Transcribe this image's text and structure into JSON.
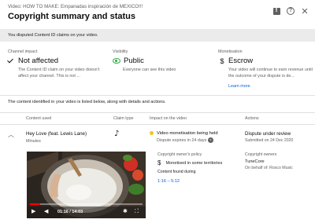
{
  "header": {
    "video_line": "Video: HOW TO MAKE: Empanadas inspiración de MEXICO!!!",
    "title": "Copyright summary and status",
    "icons": [
      "feedback-icon",
      "help-icon",
      "close-icon"
    ]
  },
  "notice": "You disputed Content ID claims on your video.",
  "cards": {
    "channel_impact": {
      "heading": "Channel impact",
      "value": "Not affected",
      "icon": "check-icon",
      "description": "The Content ID claim on your video doesn't affect your channel. This is not ..."
    },
    "visibility": {
      "heading": "Visibility",
      "value": "Public",
      "icon": "eye-icon",
      "description": "Everyone can see this video"
    },
    "monetisation": {
      "heading": "Monetisation",
      "value": "Escrow",
      "icon": "dollar-icon",
      "description": "Your video will continue to earn revenue until the outcome of your dispute is de...",
      "link": "Learn more"
    }
  },
  "content_note": "The content identified in your video is listed below, along with details and actions.",
  "columns": [
    "Content used",
    "Claim type",
    "Impact on the video",
    "Actions"
  ],
  "claim": {
    "title": "Hey Love (feat. Lewis Lane)",
    "subtitle": "Minutes",
    "claim_type_icon": "music-note-icon",
    "impact": "Video monetisation being held",
    "impact_sub": "Dispute expires in 24 days",
    "action": "Dispute under review",
    "action_sub": "Submitted on 24 Dec 2020",
    "status_color": "#f9c21d"
  },
  "video": {
    "time": "01:16 / 14:03",
    "progress": 0.09
  },
  "policy": {
    "heading": "Copyright owner's policy",
    "value": "Monetised in some territories",
    "found_heading": "Content found during",
    "found_value": "1:16 – 5:12"
  },
  "owner": {
    "heading": "Copyright owners",
    "name": "TuneCore",
    "behalf": "On behalf of: Rosco Music"
  }
}
